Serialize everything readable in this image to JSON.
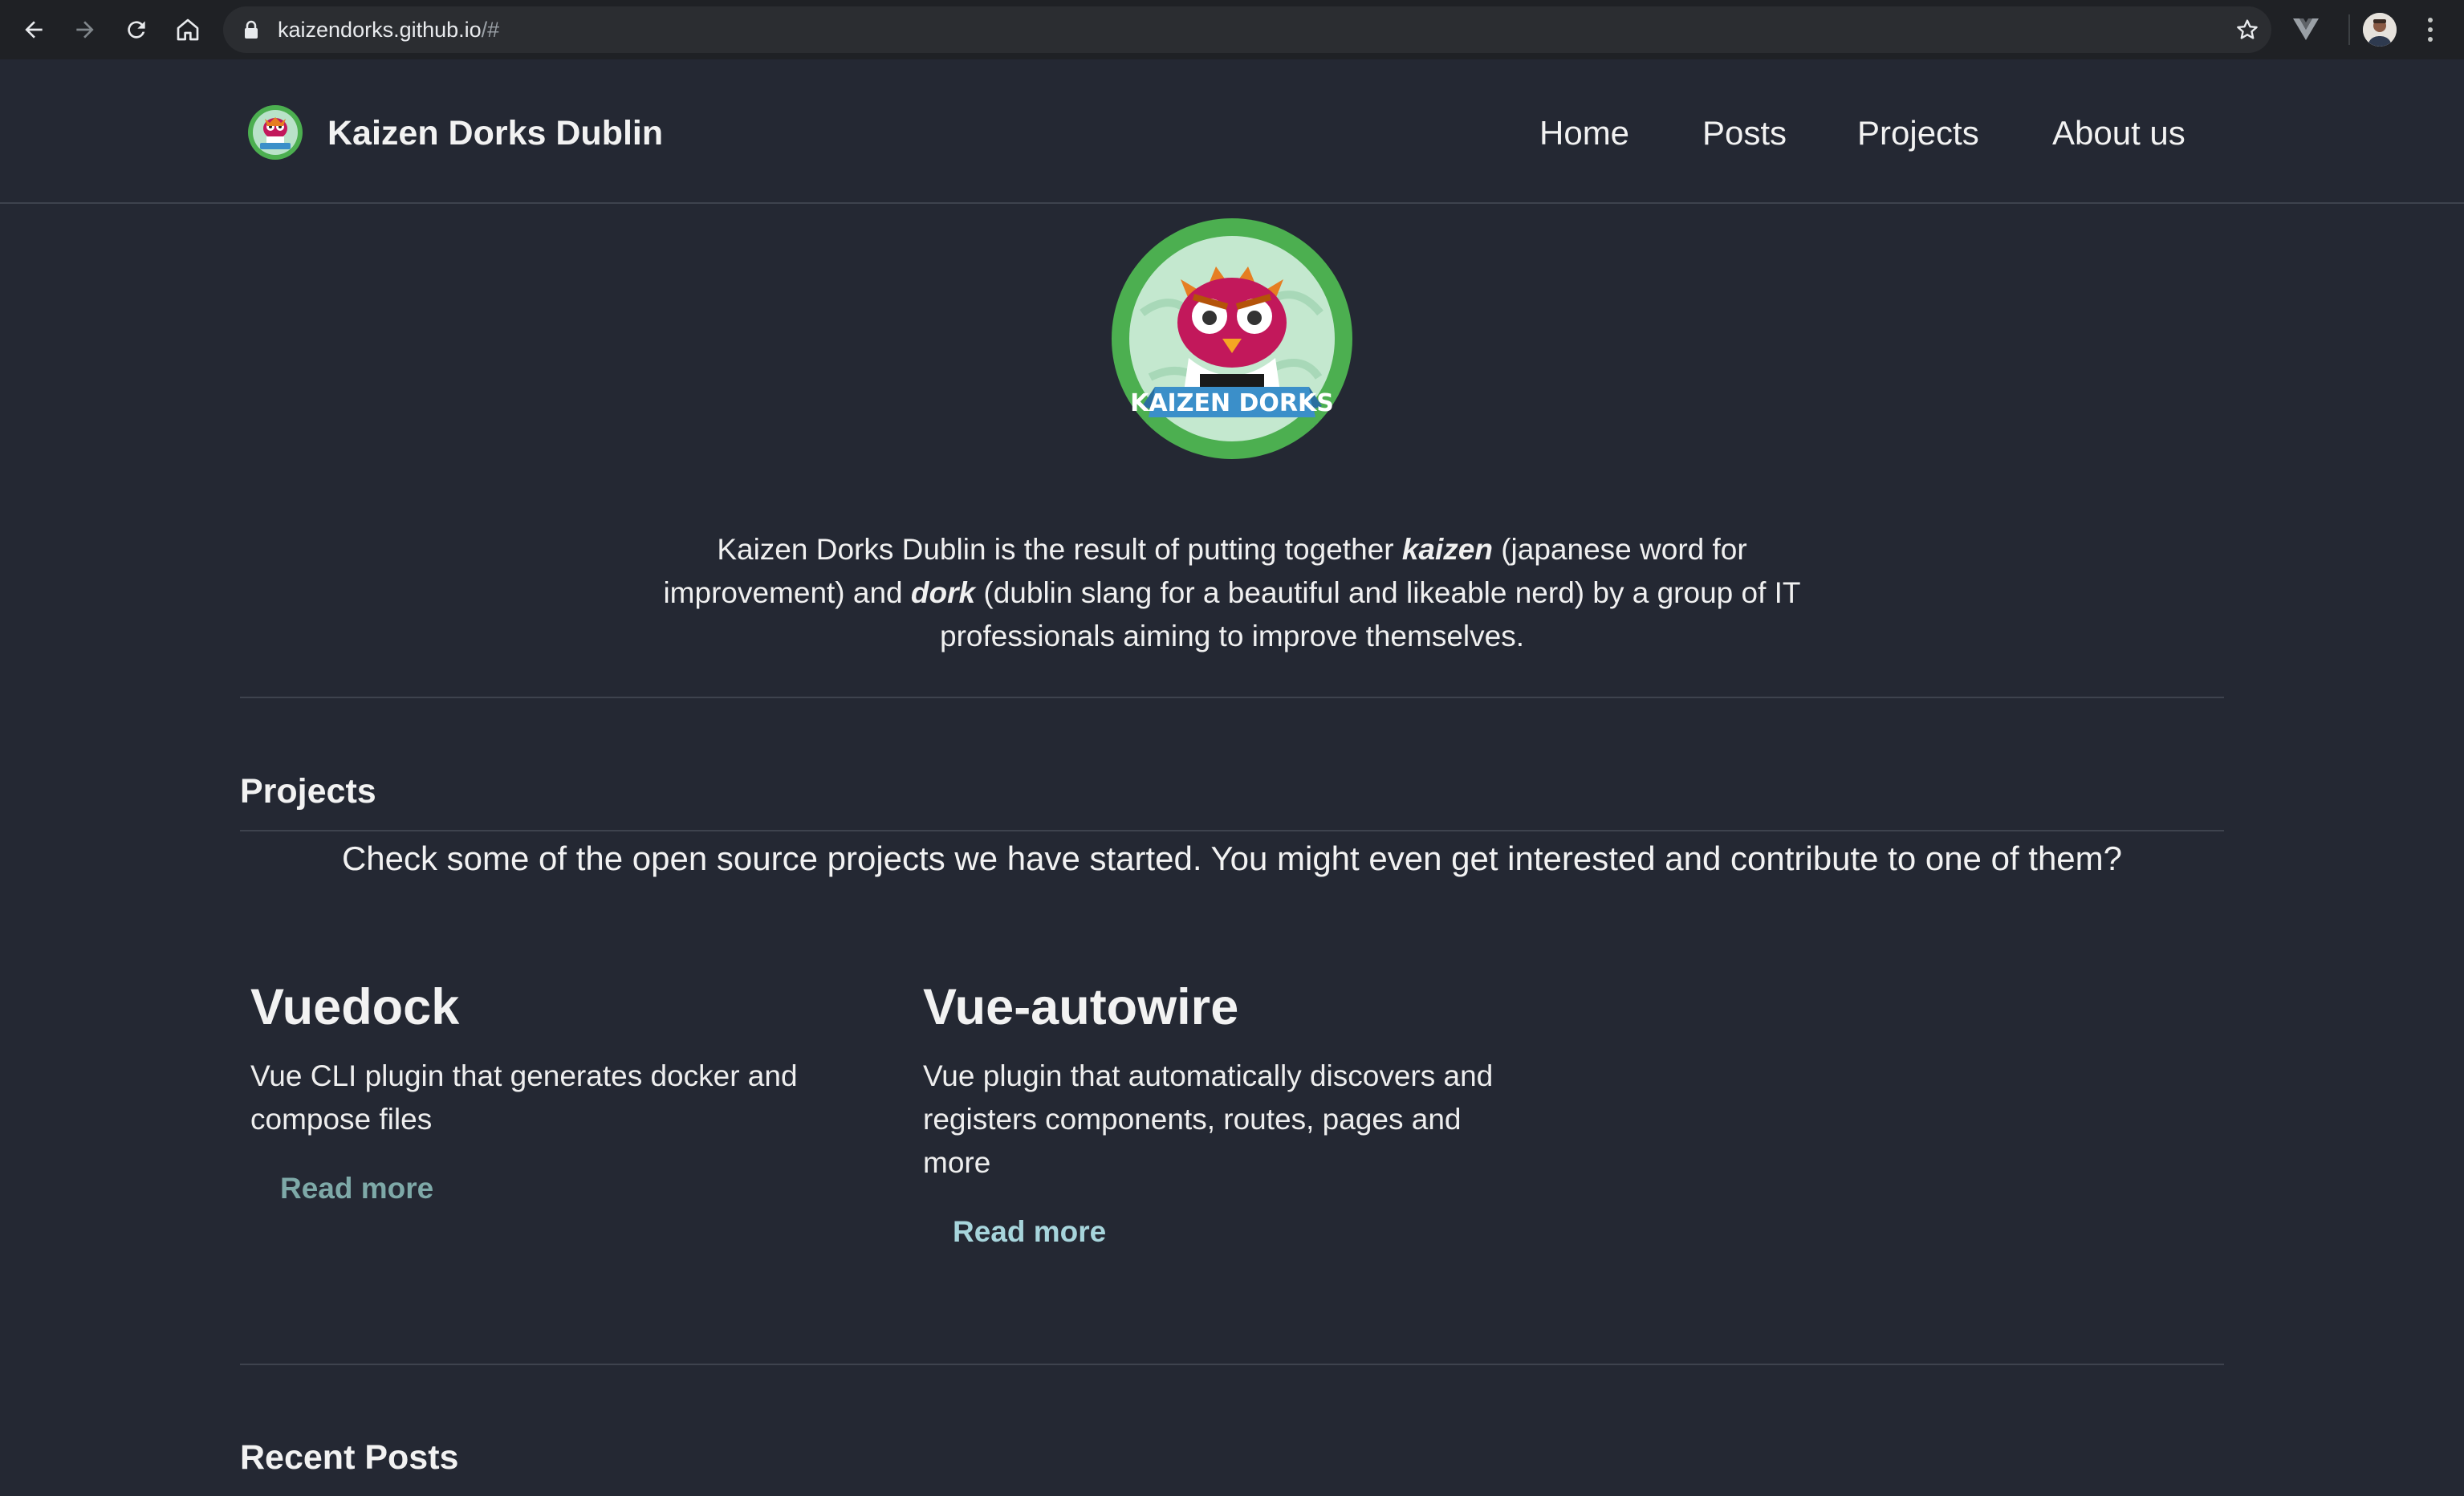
{
  "browser": {
    "url_host": "kaizendorks.github.io",
    "url_path": "/#",
    "icons": {
      "back": "back-arrow-icon",
      "forward": "forward-arrow-icon",
      "reload": "reload-icon",
      "home": "home-icon",
      "lock": "lock-icon",
      "bookmark": "star-icon",
      "extension": "vue-devtools-icon",
      "profile": "profile-avatar",
      "menu": "kebab-menu-icon"
    }
  },
  "header": {
    "site_title": "Kaizen Dorks Dublin",
    "nav": [
      "Home",
      "Posts",
      "Projects",
      "About us"
    ]
  },
  "hero": {
    "logo_text": "KAIZEN DORKS",
    "intro_part1": "Kaizen Dorks Dublin is the result of putting together ",
    "intro_kaizen": "kaizen",
    "intro_part2": " (japanese word for improvement) and ",
    "intro_dork": "dork",
    "intro_part3": " (dublin slang for a beautiful and likeable nerd) by a group of IT professionals aiming to improve themselves."
  },
  "projects": {
    "title": "Projects",
    "intro": "Check some of the open source projects we have started. You might even get interested and contribute to one of them?",
    "items": [
      {
        "name": "Vuedock",
        "description": "Vue CLI plugin that generates docker and compose files",
        "link_label": "Read more"
      },
      {
        "name": "Vue-autowire",
        "description": "Vue plugin that automatically discovers and registers components, routes, pages and more",
        "link_label": "Read more"
      }
    ]
  },
  "recent_posts": {
    "title": "Recent Posts"
  },
  "colors": {
    "page_bg": "#242833",
    "chrome_bg": "#1f2125",
    "link_primary": "#7ea9a8",
    "link_hover": "#a7d5dc",
    "logo_green": "#4caf50"
  }
}
